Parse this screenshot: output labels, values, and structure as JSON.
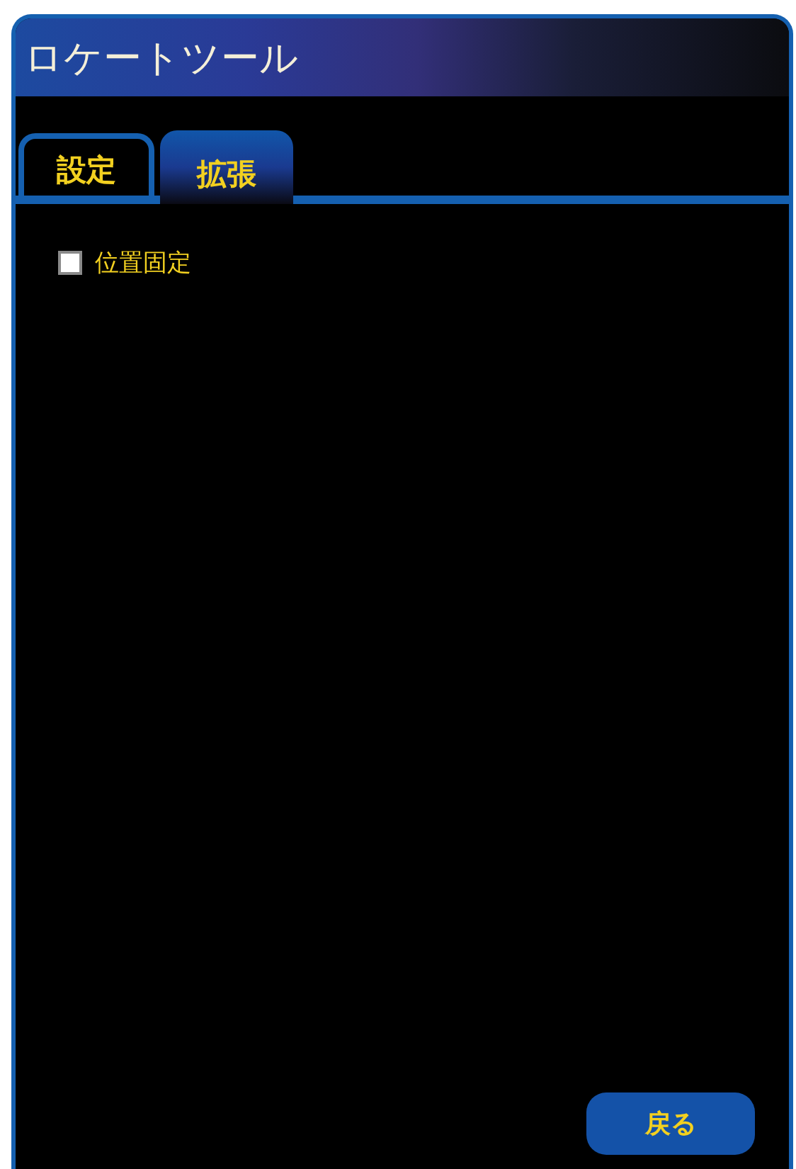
{
  "window": {
    "title": "ロケートツール"
  },
  "tabs": [
    {
      "label": "設定",
      "selected": false
    },
    {
      "label": "拡張",
      "selected": true
    }
  ],
  "options": [
    {
      "label": "位置固定",
      "checked": false
    }
  ],
  "buttons": [
    "戻る"
  ]
}
